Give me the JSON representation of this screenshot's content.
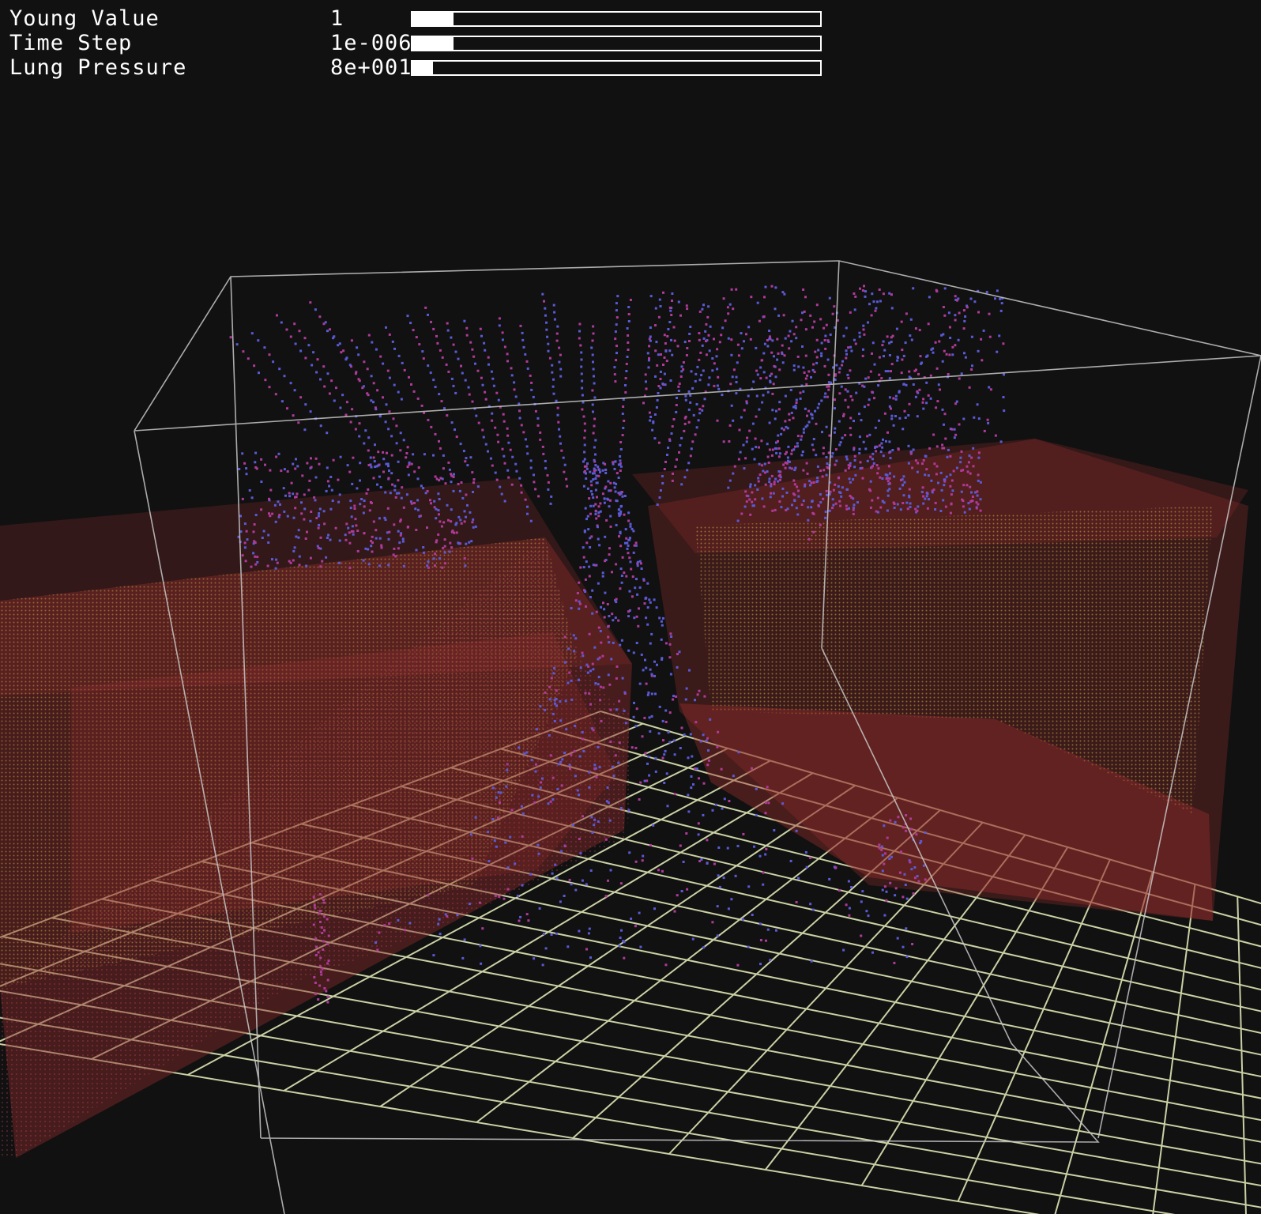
{
  "window": {
    "background": "#111111"
  },
  "sliders": [
    {
      "id": "young",
      "label": "Young Value",
      "value": "1",
      "fraction": 0.1
    },
    {
      "id": "timestep",
      "label": "Time Step",
      "value": "1e-006",
      "fraction": 0.1
    },
    {
      "id": "pressure",
      "label": "Lung Pressure",
      "value": "8e+001",
      "fraction": 0.05
    }
  ],
  "scene": {
    "grid_color": "#dde6b4",
    "box_color": "#c8c8c8",
    "tissue_color": "#8a2a2a",
    "particle_colors": [
      "#5a5ad8",
      "#b03a9a",
      "#c8a040"
    ]
  }
}
